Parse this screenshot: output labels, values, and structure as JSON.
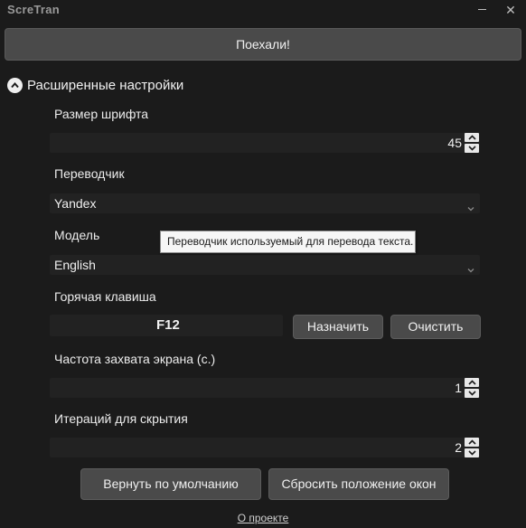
{
  "app": {
    "title": "ScreTran",
    "minimize_icon": "minimize-icon",
    "close_icon": "close-icon",
    "close_glyph": "✕"
  },
  "main": {
    "go_label": "Поехали!"
  },
  "advanced": {
    "title": "Расширенные настройки",
    "toggle_icon": "chevron-up-icon",
    "font_size": {
      "label": "Размер шрифта",
      "value": "45"
    },
    "translator": {
      "label": "Переводчик",
      "value": "Yandex",
      "tooltip": "Переводчик используемый для перевода текста."
    },
    "model": {
      "label": "Модель",
      "value": "English"
    },
    "hotkey": {
      "label": "Горячая клавиша",
      "value": "F12",
      "assign_label": "Назначить",
      "clear_label": "Очистить"
    },
    "capture_rate": {
      "label": "Частота захвата экрана (с.)",
      "value": "1"
    },
    "hide_iterations": {
      "label": "Итераций для скрытия",
      "value": "2"
    },
    "reset_defaults_label": "Вернуть по умолчанию",
    "reset_windows_label": "Сбросить положение окон"
  },
  "footer": {
    "about_label": "О проекте"
  },
  "colors": {
    "background": "#1b1b1b",
    "button": "#4a4a4a",
    "field": "#222222",
    "tooltip_bg": "#f6f6f6"
  }
}
